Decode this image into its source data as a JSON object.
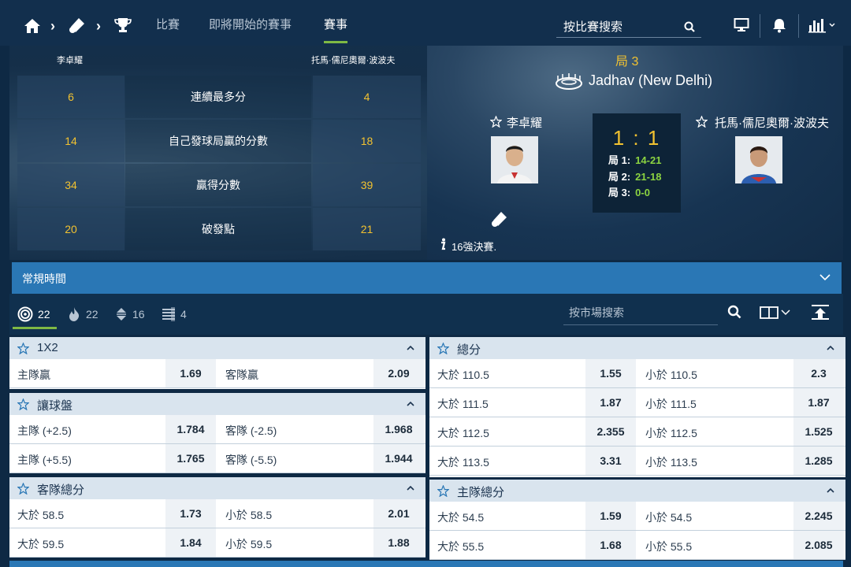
{
  "nav": {
    "tabs": [
      "比賽",
      "即將開始的賽事",
      "賽事"
    ],
    "active_tab": 2,
    "search_placeholder": "按比賽搜索"
  },
  "match": {
    "player1": "李卓耀",
    "player2": "托馬·儒尼奧爾·波波夫",
    "game_label": "局 3",
    "venue": "Jadhav (New Delhi)",
    "score": "1 : 1",
    "sets": [
      {
        "label": "局 1:",
        "value": "14-21"
      },
      {
        "label": "局 2:",
        "value": "21-18"
      },
      {
        "label": "局 3:",
        "value": "0-0"
      }
    ],
    "round_info": "16強決賽.",
    "stats": [
      {
        "label": "連續最多分",
        "p1": "6",
        "p2": "4"
      },
      {
        "label": "自己發球局贏的分數",
        "p1": "14",
        "p2": "18"
      },
      {
        "label": "贏得分數",
        "p1": "34",
        "p2": "39"
      },
      {
        "label": "破發點",
        "p1": "20",
        "p2": "21"
      }
    ]
  },
  "period": {
    "label": "常規時間"
  },
  "filters": [
    {
      "icon": "target-icon",
      "count": "22"
    },
    {
      "icon": "fire-icon",
      "count": "22"
    },
    {
      "icon": "updown-icon",
      "count": "16"
    },
    {
      "icon": "list-icon",
      "count": "4"
    }
  ],
  "market_search_placeholder": "按市場搜索",
  "markets": {
    "left": [
      {
        "title": "1X2",
        "rows": [
          {
            "a_label": "主隊贏",
            "a_price": "1.69",
            "b_label": "客隊贏",
            "b_price": "2.09"
          }
        ]
      },
      {
        "title": "讓球盤",
        "rows": [
          {
            "a_label": "主隊 (+2.5)",
            "a_price": "1.784",
            "b_label": "客隊 (-2.5)",
            "b_price": "1.968"
          },
          {
            "a_label": "主隊 (+5.5)",
            "a_price": "1.765",
            "b_label": "客隊 (-5.5)",
            "b_price": "1.944"
          }
        ]
      },
      {
        "title": "客隊總分",
        "rows": [
          {
            "a_label": "大於 58.5",
            "a_price": "1.73",
            "b_label": "小於 58.5",
            "b_price": "2.01"
          },
          {
            "a_label": "大於 59.5",
            "a_price": "1.84",
            "b_label": "小於 59.5",
            "b_price": "1.88"
          }
        ]
      }
    ],
    "right": [
      {
        "title": "總分",
        "rows": [
          {
            "a_label": "大於 110.5",
            "a_price": "1.55",
            "b_label": "小於 110.5",
            "b_price": "2.3"
          },
          {
            "a_label": "大於 111.5",
            "a_price": "1.87",
            "b_label": "小於 111.5",
            "b_price": "1.87"
          },
          {
            "a_label": "大於 112.5",
            "a_price": "2.355",
            "b_label": "小於 112.5",
            "b_price": "1.525"
          },
          {
            "a_label": "大於 113.5",
            "a_price": "3.31",
            "b_label": "小於 113.5",
            "b_price": "1.285"
          }
        ]
      },
      {
        "title": "主隊總分",
        "rows": [
          {
            "a_label": "大於 54.5",
            "a_price": "1.59",
            "b_label": "小於 54.5",
            "b_price": "2.245"
          },
          {
            "a_label": "大於 55.5",
            "a_price": "1.68",
            "b_label": "小於 55.5",
            "b_price": "2.085"
          }
        ]
      }
    ]
  }
}
